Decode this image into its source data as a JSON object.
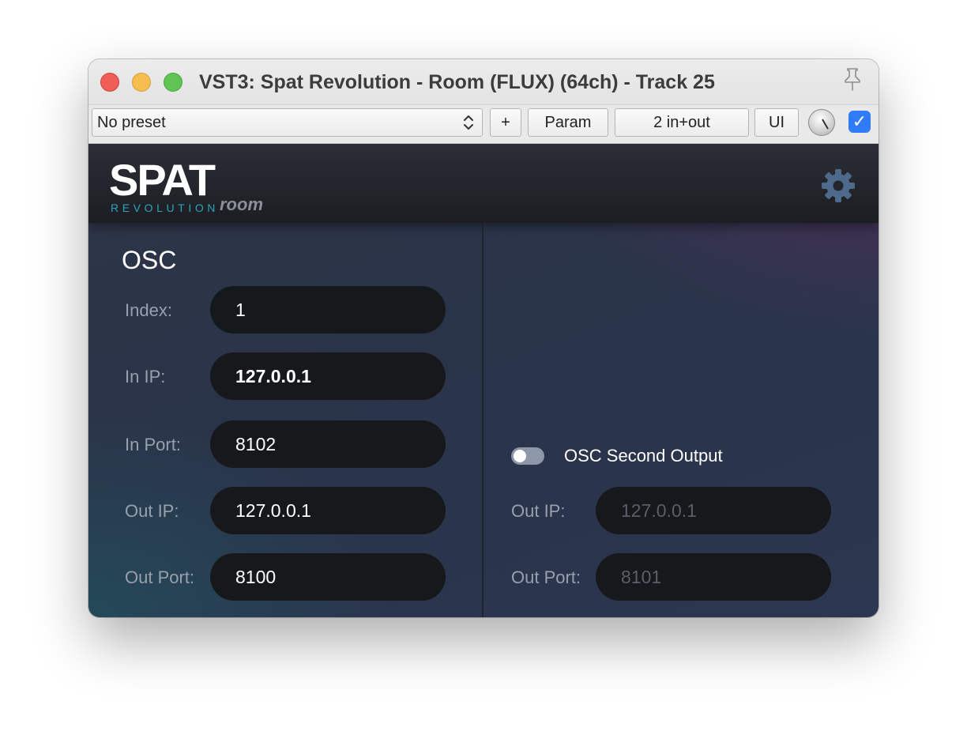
{
  "window": {
    "title": "VST3: Spat Revolution - Room (FLUX) (64ch) - Track 25"
  },
  "toolbar": {
    "preset": "No preset",
    "plus_label": "+",
    "param_label": "Param",
    "io_label": "2 in+out",
    "ui_label": "UI",
    "bypass_checked": true
  },
  "plugin": {
    "logo_main": "SPAT",
    "logo_sub": "REVOLUTION",
    "logo_variant": "room",
    "osc_title": "OSC",
    "left": {
      "index_label": "Index:",
      "index_value": "1",
      "in_ip_label": "In IP:",
      "in_ip_value": "127.0.0.1",
      "in_port_label": "In Port:",
      "in_port_value": "8102",
      "out_ip_label": "Out IP:",
      "out_ip_value": "127.0.0.1",
      "out_port_label": "Out Port:",
      "out_port_value": "8100"
    },
    "right": {
      "second_output_label": "OSC Second Output",
      "second_output_enabled": false,
      "out_ip_label": "Out IP:",
      "out_ip_value": "127.0.0.1",
      "out_port_label": "Out Port:",
      "out_port_value": "8101"
    }
  },
  "colors": {
    "accent_blue": "#2f7cf6",
    "logo_teal": "#2aa3bf",
    "field_bg": "#17181c"
  }
}
